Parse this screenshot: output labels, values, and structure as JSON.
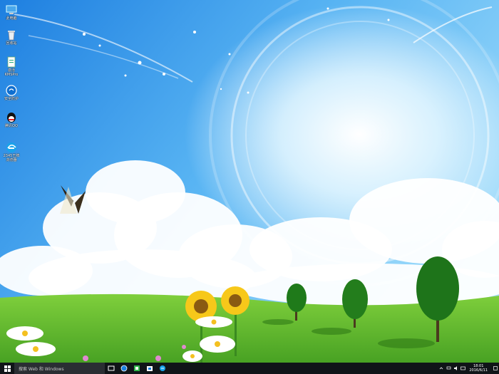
{
  "desktop": {
    "icons": [
      {
        "name": "computer-icon",
        "label": "此电脑"
      },
      {
        "name": "recycle-bin-icon",
        "label": "回收站"
      },
      {
        "name": "document-icon",
        "label": "激活KMSPro"
      },
      {
        "name": "security-icon",
        "label": "安全防护"
      },
      {
        "name": "qq-icon",
        "label": "腾讯QQ"
      },
      {
        "name": "browser-icon",
        "label": "2345王牌浏览器"
      }
    ]
  },
  "taskbar": {
    "search_placeholder": "搜索 Web 和 Windows",
    "time": "18:01",
    "date": "2016/6/11"
  },
  "colors": {
    "sky_top": "#1f8be8",
    "sky_mid": "#6fc3f5",
    "grass": "#5cb832",
    "taskbar": "#101418"
  }
}
